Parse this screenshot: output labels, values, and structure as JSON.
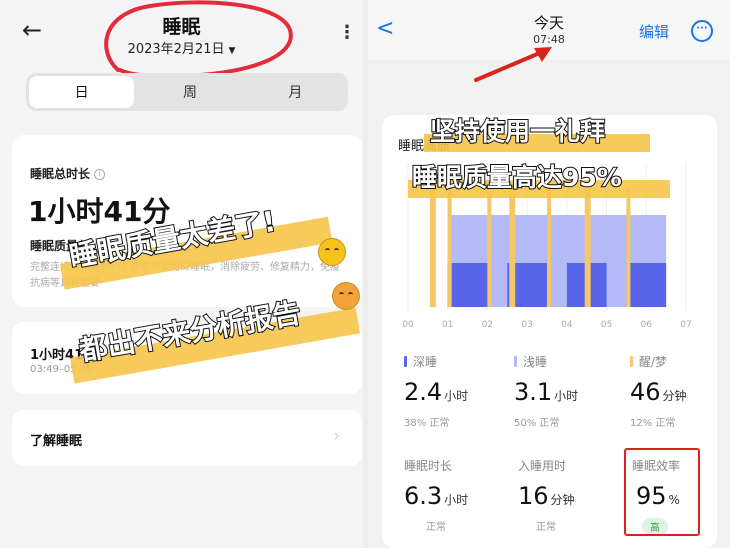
{
  "left": {
    "title": "睡眠",
    "date": "2023年2月21日",
    "tabs": [
      "日",
      "周",
      "月"
    ],
    "total_label": "睡眠总时长",
    "total_value": "1小时41分",
    "quality_label": "睡眠质量差",
    "quality_desc": "完整连续的睡眠有利于获得充足的深睡眠，消除疲劳、修复精力，免疫抗病等具有重要",
    "session_duration": "1小时41分",
    "session_time": "03:49–05:30",
    "learn_label": "了解睡眠",
    "overlay_line1": "睡眠质量太差了!",
    "overlay_line2": "都出不来分析报告"
  },
  "right": {
    "title": "今天",
    "time": "07:48",
    "edit_label": "编辑",
    "chart_title": "睡眠高质",
    "overlay_line1": "坚持使用一礼拜",
    "overlay_line2": "睡眠质量高达95%",
    "stats": {
      "deep": {
        "label": "深睡",
        "value": "2.4",
        "unit": "小时",
        "sub": "38% 正常"
      },
      "light": {
        "label": "浅睡",
        "value": "3.1",
        "unit": "小时",
        "sub": "50% 正常"
      },
      "rem": {
        "label": "醒/梦",
        "value": "46",
        "unit": "分钟",
        "sub": "12% 正常"
      },
      "duration": {
        "label": "睡眠时长",
        "value": "6.3",
        "unit": "小时",
        "sub": "正常"
      },
      "fall_asleep": {
        "label": "入睡用时",
        "value": "16",
        "unit": "分钟",
        "sub": "正常"
      },
      "efficiency": {
        "label": "睡眠效率",
        "value": "95",
        "unit": "%",
        "badge": "高"
      }
    }
  },
  "colors": {
    "deep": "#5865e8",
    "light": "#b4baf7",
    "rem": "#f6c766",
    "accent": "#1a73e8",
    "annotation": "#d9241a"
  },
  "chart_data": {
    "type": "bar",
    "x_ticks": [
      "00",
      "01",
      "02",
      "03",
      "04",
      "05",
      "06",
      "07"
    ],
    "x_range_hours": [
      0,
      7
    ],
    "series": [
      {
        "name": "深睡",
        "segments": [
          [
            1.0,
            2.0
          ],
          [
            2.5,
            3.5
          ],
          [
            4.0,
            5.0
          ],
          [
            5.5,
            6.5
          ]
        ]
      },
      {
        "name": "浅睡",
        "segments": [
          [
            1.0,
            6.5
          ]
        ]
      },
      {
        "name": "醒/梦",
        "segments": [
          [
            0.55,
            0.7
          ],
          [
            1.0,
            1.1
          ],
          [
            2.0,
            2.1
          ],
          [
            2.55,
            2.7
          ],
          [
            3.5,
            3.6
          ],
          [
            4.45,
            4.6
          ],
          [
            5.5,
            5.6
          ]
        ]
      }
    ]
  }
}
